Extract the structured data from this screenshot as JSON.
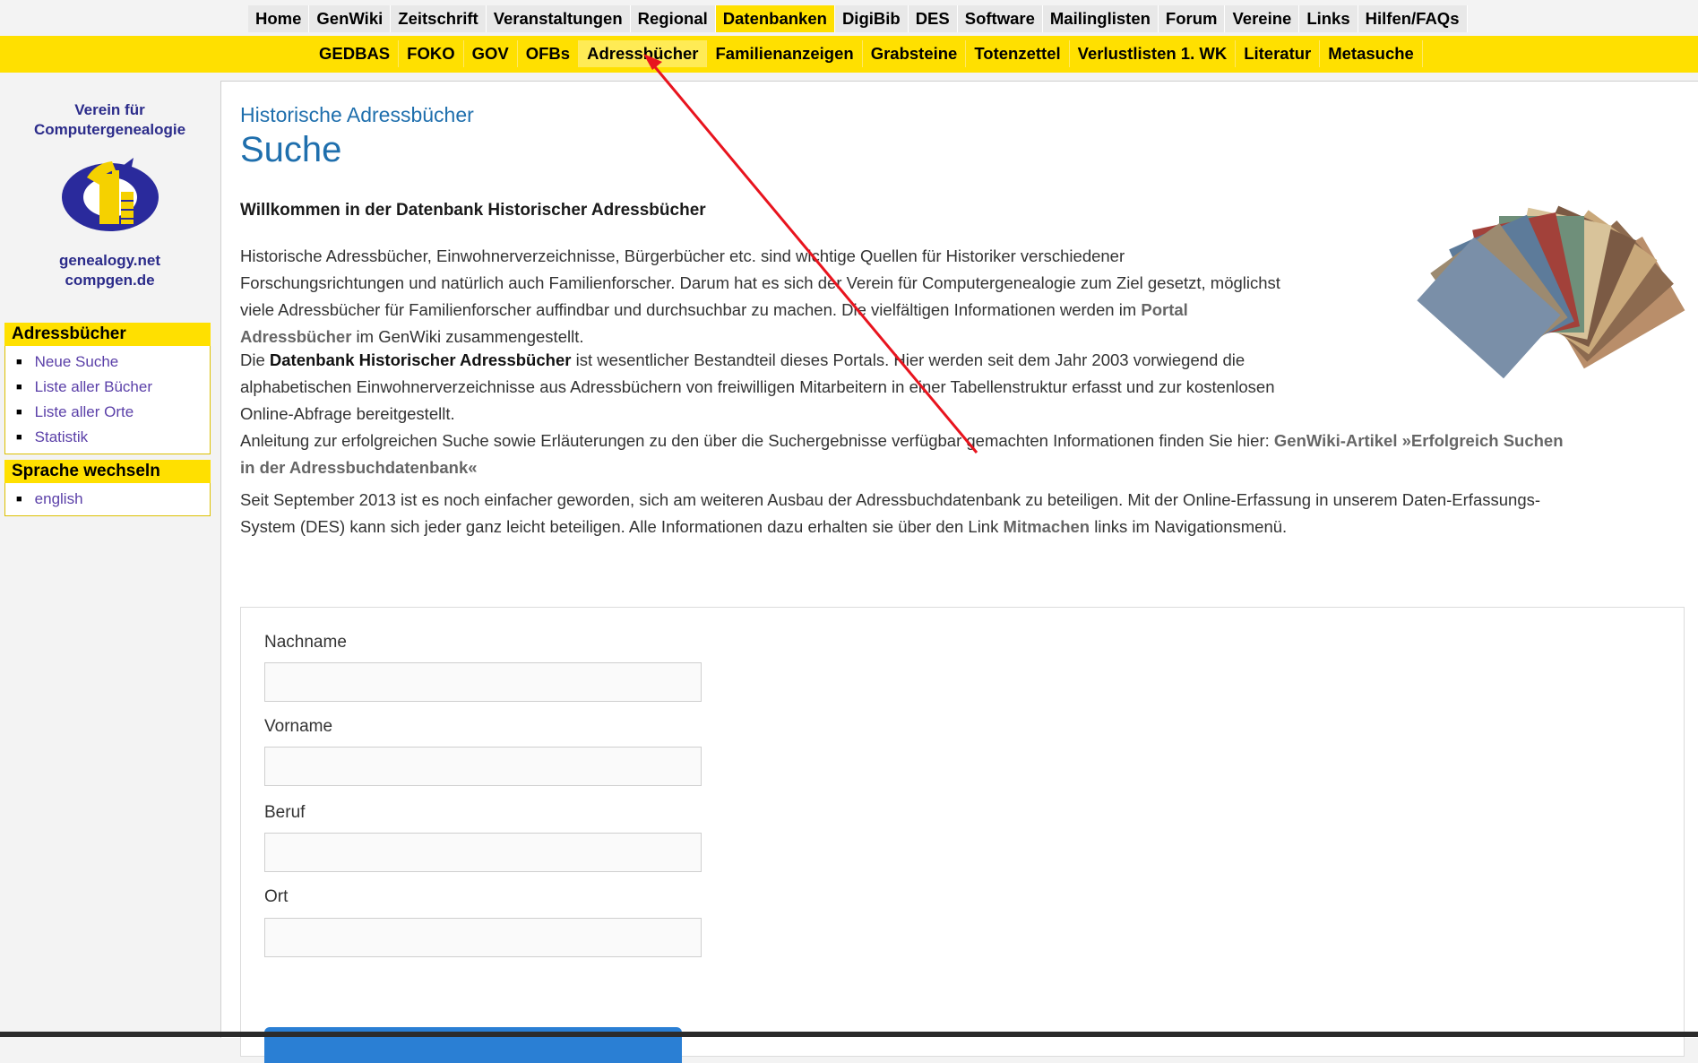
{
  "topnav": {
    "items": [
      {
        "label": "Home"
      },
      {
        "label": "GenWiki"
      },
      {
        "label": "Zeitschrift"
      },
      {
        "label": "Veranstaltungen"
      },
      {
        "label": "Regional"
      },
      {
        "label": "Datenbanken",
        "active": true
      },
      {
        "label": "DigiBib"
      },
      {
        "label": "DES"
      },
      {
        "label": "Software"
      },
      {
        "label": "Mailinglisten"
      },
      {
        "label": "Forum"
      },
      {
        "label": "Vereine"
      },
      {
        "label": "Links"
      },
      {
        "label": "Hilfen/FAQs"
      }
    ]
  },
  "subnav": {
    "items": [
      {
        "label": "GEDBAS"
      },
      {
        "label": "FOKO"
      },
      {
        "label": "GOV"
      },
      {
        "label": "OFBs"
      },
      {
        "label": "Adressbücher",
        "active": true
      },
      {
        "label": "Familienanzeigen"
      },
      {
        "label": "Grabsteine"
      },
      {
        "label": "Totenzettel"
      },
      {
        "label": "Verlustlisten 1. WK"
      },
      {
        "label": "Literatur"
      },
      {
        "label": "Metasuche"
      }
    ]
  },
  "sidebar": {
    "logo_title_1": "Verein für",
    "logo_title_2": "Computergenealogie",
    "logo_sub_1": "genealogy.net",
    "logo_sub_2": "compgen.de",
    "box1": {
      "title": "Adressbücher",
      "items": [
        {
          "label": "Neue Suche"
        },
        {
          "label": "Liste aller Bücher"
        },
        {
          "label": "Liste aller Orte"
        },
        {
          "label": "Statistik"
        }
      ]
    },
    "box2": {
      "title": "Sprache wechseln",
      "items": [
        {
          "label": "english"
        }
      ]
    }
  },
  "content": {
    "breadcrumb": "Historische Adressbücher",
    "title": "Suche",
    "welcome": "Willkommen in der Datenbank Historischer Adressbücher",
    "p1_a": "Historische Adressbücher, Einwohnerverzeichnisse, Bürgerbücher etc. sind wichtige Quellen für Historiker verschiedener",
    "p1_b": "Forschungsrichtungen und natürlich auch Familienforscher. Darum hat es sich der Verein für Computergenealogie zum Ziel gesetzt, möglichst",
    "p1_c": "viele Adressbücher für Familienforscher auffindbar und durchsuchbar zu machen. Die vielfältigen Informationen werden im",
    "p1_link1": "Portal",
    "p1_link2": "Adressbücher",
    "p1_d": "im GenWiki zusammengestellt.",
    "p2_a": "Die",
    "p2_bold": "Datenbank Historischer Adressbücher",
    "p2_b": "ist wesentlicher Bestandteil dieses Portals. Hier werden seit dem Jahr 2003 vorwiegend die",
    "p2_c": "alphabetischen Einwohnerverzeichnisse aus Adressbüchern von freiwilligen Mitarbeitern in einer Tabellenstruktur erfasst und zur kostenlosen",
    "p2_d": "Online-Abfrage bereitgestellt.",
    "p3_a": "Anleitung zur erfolgreichen Suche sowie Erläuterungen zu den über die Suchergebnisse verfügbar gemachten Informationen finden Sie hier:",
    "p3_link1": "GenWiki-Artikel »Erfolgreich Suchen",
    "p3_link2": "in der Adressbuchdatenbank«",
    "p4_a": "Seit September 2013 ist es noch einfacher geworden, sich am weiteren Ausbau der Adressbuchdatenbank zu beteiligen. Mit der Online-Erfassung in unserem Daten-Erfassungs-",
    "p4_b": "System (DES) kann sich jeder ganz leicht beteiligen. Alle Informationen dazu erhalten sie über den Link",
    "p4_link": "Mitmachen",
    "p4_c": "links im Navigationsmenü."
  },
  "form": {
    "nachname_label": "Nachname",
    "nachname_value": "",
    "vorname_label": "Vorname",
    "vorname_value": "",
    "beruf_label": "Beruf",
    "beruf_value": "",
    "ort_label": "Ort",
    "ort_value": ""
  },
  "colors": {
    "nav_yellow": "#ffe000",
    "title_blue": "#1f6fad",
    "link_purple": "#5a3fa8",
    "annotation_red": "#e8141e",
    "button_blue": "#2a7fd4"
  },
  "annotation": {
    "type": "arrow",
    "target": "Adressbücher"
  }
}
